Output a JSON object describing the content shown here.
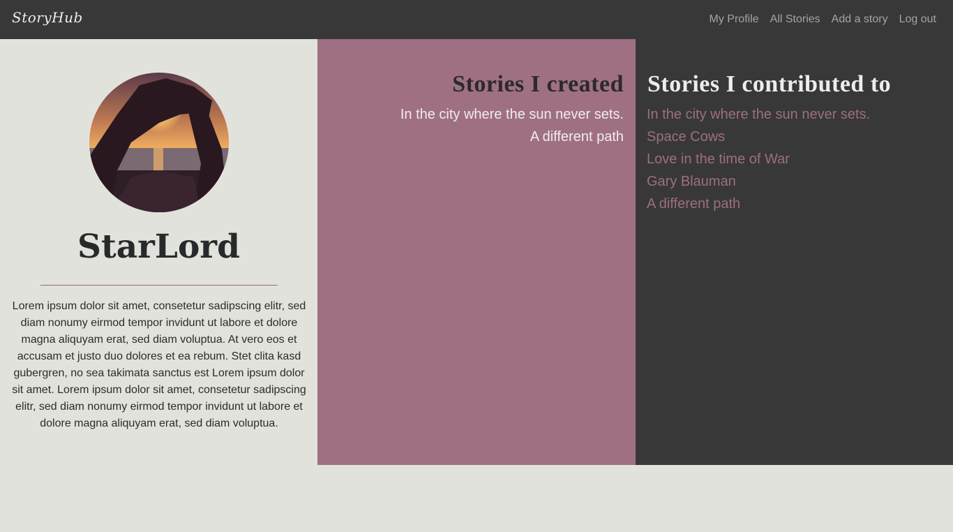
{
  "navbar": {
    "brand": "StoryHub",
    "links": [
      "My Profile",
      "All Stories",
      "Add a story",
      "Log out"
    ]
  },
  "profile": {
    "avatar": "sunset-photo",
    "username": "StarLord",
    "bio": "Lorem ipsum dolor sit amet, consetetur sadipscing elitr, sed diam nonumy eirmod tempor invidunt ut labore et dolore magna aliquyam erat, sed diam voluptua. At vero eos et accusam et justo duo dolores et ea rebum. Stet clita kasd gubergren, no sea takimata sanctus est Lorem ipsum dolor sit amet. Lorem ipsum dolor sit amet, consetetur sadipscing elitr, sed diam nonumy eirmod tempor invidunt ut labore et dolore magna aliquyam erat, sed diam voluptua."
  },
  "created": {
    "heading": "Stories I created",
    "stories": [
      "In the city where the sun never sets.",
      "A different path"
    ]
  },
  "contributed": {
    "heading": "Stories I contributed to",
    "stories": [
      "In the city where the sun never sets.",
      "Space Cows",
      "Love in the time of War",
      "Gary Blauman",
      "A different path"
    ]
  },
  "colors": {
    "navbar": "#383838",
    "page_bg": "#e2e2dc",
    "accent": "#9f7083",
    "dark_panel": "#383838",
    "nav_link": "#a4a4a4",
    "contrib_link": "#9d6e82"
  }
}
